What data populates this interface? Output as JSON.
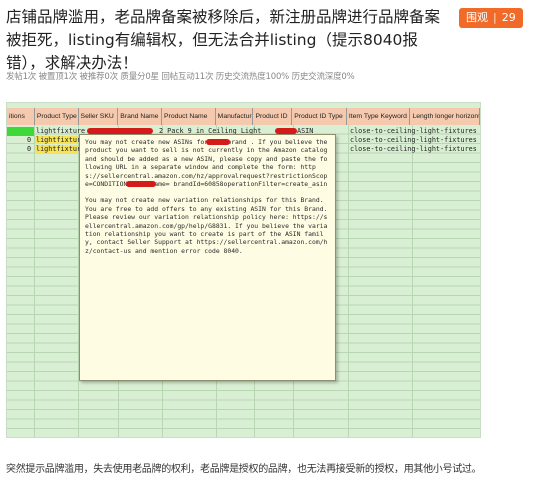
{
  "post": {
    "title": "店铺品牌滥用，老品牌备案被移除后，新注册品牌进行品牌备案被拒死，listing有编辑权，但无法合并listing（提示8040报错），求解决办法！",
    "badge_label": "围观",
    "badge_count": "29",
    "stats": "发帖1次 被置顶1次 被推荐0次 质量分0星 回帖互动11次 历史交流热度100% 历史交流深度0%",
    "caption": "突然提示品牌滥用，失去使用老品牌的权利，老品牌是授权的品牌，也无法再接受新的授权，用其他小号试过。"
  },
  "sheet": {
    "columns": [
      "itions",
      "Product Type",
      "Seller SKU",
      "Brand Name",
      "Product Name",
      "Manufacturer",
      "Product ID",
      "Product ID Type",
      "Item Type Keyword",
      "Length longer horizont"
    ],
    "row1": {
      "product_type": "lightfixture",
      "product_name": "2 Pack 9 in Ceiling Light",
      "product_id_type": "ASIN",
      "keyword": "close-to-ceiling-light-fixtures"
    },
    "row2": {
      "num": "0",
      "product_type": "lightfixture",
      "keyword": "close-to-ceiling-light-fixtures"
    },
    "row3": {
      "num": "0",
      "product_type": "lightfixture",
      "keyword": "close-to-ceiling-light-fixtures"
    }
  },
  "popup": {
    "para1": "You may not create new ASINs for the brand           . If you believe the product you want to sell is not currently in the Amazon catalog and should be added as a new ASIN, please copy and paste the following URL in a separate window and complete the form: https://sellercentral.amazon.com/hz/approvalrequest?restrictionScope=CONDITION%BrandName=            brandId=60858operationFilter=create_asin",
    "para2": "You may not create new variation relationships for this Brand. You are free to add offers to any existing ASIN for this Brand. Please review our variation relationship policy here: https://sellercentral.amazon.com/gp/help/G8831. If you believe the variation relationship you want to create is part of the ASIN family, contact Seller Support at https://sellercentral.amazon.com/hz/contact-us and mention error code 8040."
  },
  "colors": {
    "badge": "#f26a28",
    "header": "#f4c9ad",
    "sheet": "#d9efd4",
    "highlight_green": "#3ed83a",
    "highlight_yellow": "#f7e25a",
    "redaction": "#d51a1a"
  }
}
